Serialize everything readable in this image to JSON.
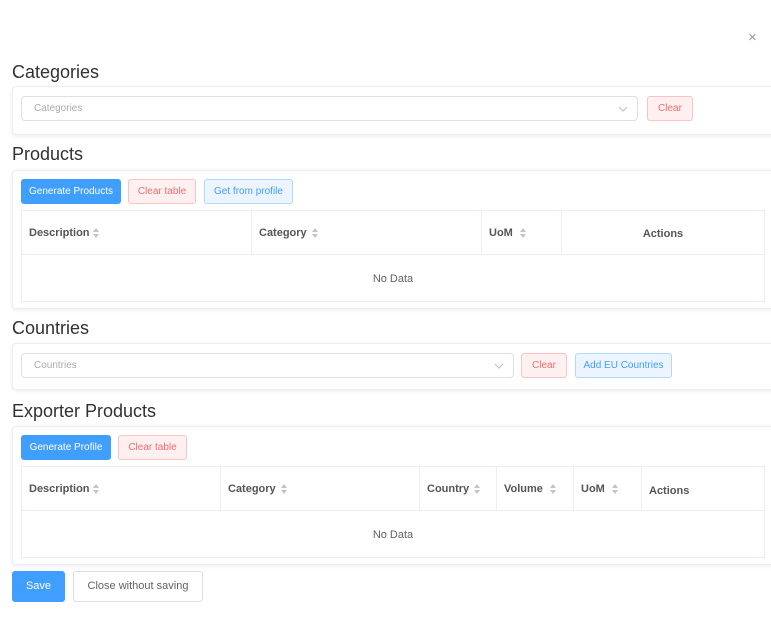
{
  "dialog": {
    "close_glyph": "×",
    "close_icon": "close-icon"
  },
  "categories": {
    "title": "Categories",
    "select_placeholder": "Categories",
    "clear_label": "Clear"
  },
  "products": {
    "title": "Products",
    "generate_label": "Generate Products",
    "clear_table_label": "Clear table",
    "get_from_profile_label": "Get from profile",
    "columns": [
      "Description",
      "Category",
      "UoM",
      "Actions"
    ],
    "empty_text": "No Data"
  },
  "countries": {
    "title": "Countries",
    "select_placeholder": "Countries",
    "clear_label": "Clear",
    "add_eu_label": "Add EU Countries"
  },
  "exporter_products": {
    "title": "Exporter Products",
    "generate_label": "Generate Profile",
    "clear_table_label": "Clear table",
    "columns": [
      "Description",
      "Category",
      "Country",
      "Volume",
      "UoM",
      "Actions"
    ],
    "empty_text": "No Data"
  },
  "footer": {
    "save_label": "Save",
    "close_label": "Close without saving"
  },
  "colors": {
    "primary": "#409eff",
    "danger": "#f56c6c",
    "border": "#ebeef5"
  }
}
